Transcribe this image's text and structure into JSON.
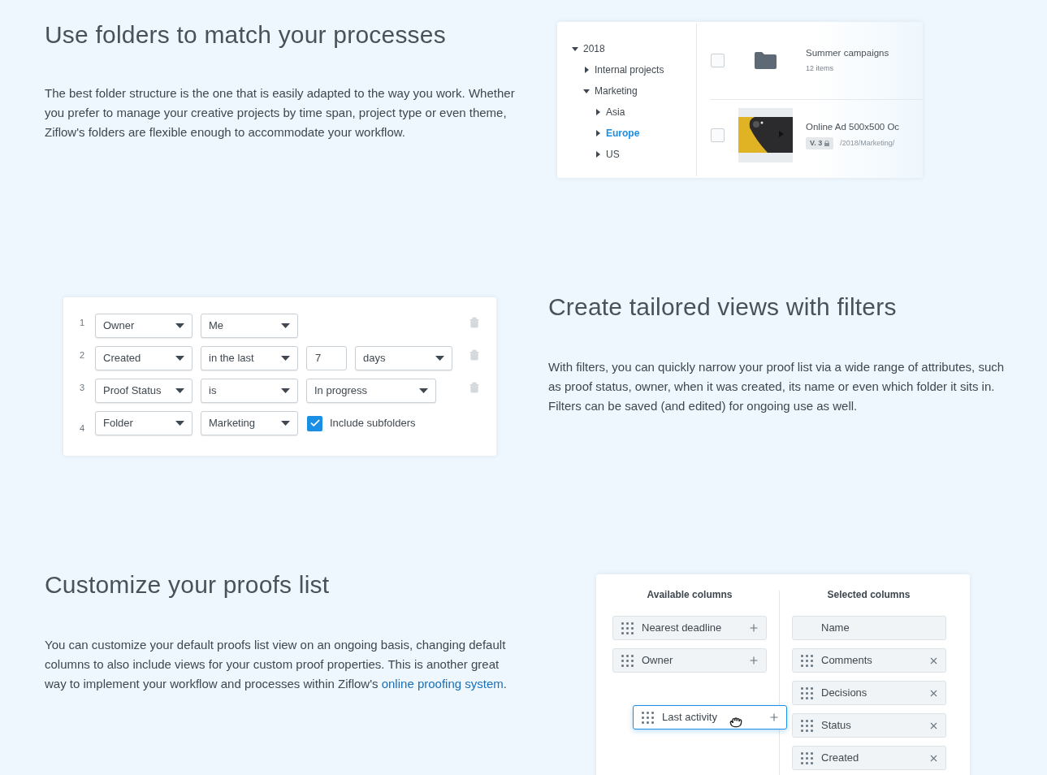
{
  "folders_section": {
    "heading": "Use folders to match your processes",
    "paragraph": "The best folder structure is the one that is easily adapted to the way you work. Whether you prefer to manage your creative projects by time span, project type or even theme, Ziflow's folders are flexible enough to accommodate your workflow.",
    "tree": [
      {
        "label": "2018",
        "expanded": true,
        "selected": false,
        "children": [
          {
            "label": "Internal projects",
            "expanded": false,
            "selected": false
          },
          {
            "label": "Marketing",
            "expanded": true,
            "selected": false,
            "children": [
              {
                "label": "Asia",
                "expanded": false,
                "selected": false
              },
              {
                "label": "Europe",
                "expanded": false,
                "selected": true
              },
              {
                "label": "US",
                "expanded": false,
                "selected": false
              }
            ]
          }
        ]
      }
    ],
    "items": [
      {
        "kind": "folder",
        "checked": false,
        "title": "Summer campaigns",
        "subtitle": "12 items"
      },
      {
        "kind": "proof",
        "checked": false,
        "title": "Online Ad 500x500 Oc",
        "version": "V. 3",
        "path": "/2018/Marketing/"
      }
    ]
  },
  "filters_section": {
    "heading": "Create tailored views with filters",
    "paragraph": "With filters, you can quickly narrow your proof list via a wide range of attributes, such as proof status, owner, when it was created, its name or even which folder it sits in. Filters can be saved (and edited) for ongoing use as well.",
    "rows": [
      {
        "number": "1",
        "removable": true,
        "fields": [
          {
            "kind": "select",
            "value": "Owner"
          },
          {
            "kind": "select",
            "value": "Me"
          }
        ]
      },
      {
        "number": "2",
        "removable": true,
        "fields": [
          {
            "kind": "select",
            "value": "Created"
          },
          {
            "kind": "select",
            "value": "in the last"
          },
          {
            "kind": "input",
            "value": "7"
          },
          {
            "kind": "select",
            "value": "days"
          }
        ]
      },
      {
        "number": "3",
        "removable": true,
        "fields": [
          {
            "kind": "select",
            "value": "Proof Status"
          },
          {
            "kind": "select",
            "value": "is"
          },
          {
            "kind": "wide_select",
            "value": "In progress"
          }
        ]
      },
      {
        "number": "4",
        "removable": false,
        "fields": [
          {
            "kind": "select",
            "value": "Folder"
          },
          {
            "kind": "select",
            "value": "Marketing"
          },
          {
            "kind": "checkbox",
            "label": "Include subfolders",
            "checked": true
          }
        ]
      }
    ]
  },
  "columns_section": {
    "heading": "Customize your proofs list",
    "paragraph": "You can customize your default proofs list view on an ongoing basis, changing default columns to also include views for your custom proof properties. This is another great way to implement your workflow and processes within Ziflow's",
    "link": "online proofing system",
    "link_end": ".",
    "available": {
      "title": "Available columns",
      "items": [
        {
          "label": "Nearest deadline",
          "dragging": false
        },
        {
          "label": "Owner",
          "dragging": false
        },
        {
          "label": "Last activity",
          "dragging": true
        }
      ]
    },
    "selected": {
      "title": "Selected columns",
      "items": [
        {
          "label": "Name",
          "fixed": true
        },
        {
          "label": "Comments",
          "fixed": false
        },
        {
          "label": "Decisions",
          "fixed": false
        },
        {
          "label": "Status",
          "fixed": false
        },
        {
          "label": "Created",
          "fixed": false
        }
      ]
    }
  }
}
